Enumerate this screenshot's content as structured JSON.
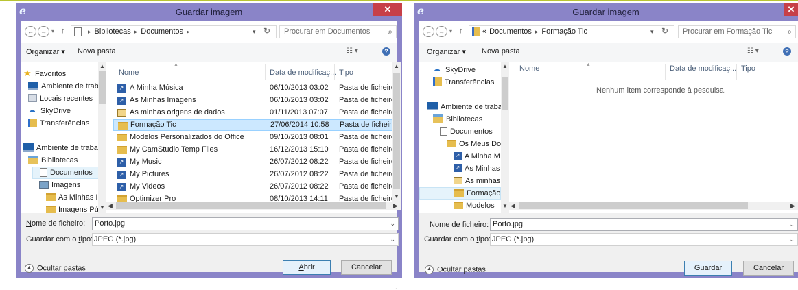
{
  "dialog_left": {
    "title": "Guardar imagem",
    "close_glyph": "✕",
    "address": {
      "segments": [
        "Bibliotecas",
        "Documentos"
      ]
    },
    "search": {
      "placeholder": "Procurar em Documentos"
    },
    "toolbar": {
      "organize": "Organizar ▾",
      "new_folder": "Nova pasta"
    },
    "nav_items": [
      {
        "label": "Favoritos",
        "icon": "star-icon"
      },
      {
        "label": "Ambiente de trab",
        "icon": "desktop-icon"
      },
      {
        "label": "Locais recentes",
        "icon": "recent-places-icon"
      },
      {
        "label": "SkyDrive",
        "icon": "cloud-icon"
      },
      {
        "label": "Transferências",
        "icon": "downloads-icon"
      },
      {
        "label": "Ambiente de traba",
        "icon": "desktop-icon"
      },
      {
        "label": "Bibliotecas",
        "icon": "library-icon"
      },
      {
        "label": "Documentos",
        "icon": "document-icon",
        "selected": true
      },
      {
        "label": "Imagens",
        "icon": "image-icon"
      },
      {
        "label": "As Minhas Im",
        "icon": "image-folder-icon"
      },
      {
        "label": "Imagens Púb",
        "icon": "image-folder-icon"
      }
    ],
    "columns": [
      "Nome",
      "Data de modificaç...",
      "Tipo"
    ],
    "files": [
      {
        "name": "A Minha Música",
        "date": "06/10/2013 03:02",
        "type": "Pasta de ficheiros",
        "icon": "shortcut-icon"
      },
      {
        "name": "As Minhas Imagens",
        "date": "06/10/2013 03:02",
        "type": "Pasta de ficheiros",
        "icon": "shortcut-icon"
      },
      {
        "name": "As minhas origens de dados",
        "date": "01/11/2013 07:07",
        "type": "Pasta de ficheiros",
        "icon": "data-source-icon"
      },
      {
        "name": "Formação Tic",
        "date": "27/06/2014 10:58",
        "type": "Pasta de ficheiros",
        "icon": "folder-icon",
        "selected": true
      },
      {
        "name": "Modelos Personalizados do Office",
        "date": "09/10/2013 08:01",
        "type": "Pasta de ficheiros",
        "icon": "folder-icon"
      },
      {
        "name": "My CamStudio Temp Files",
        "date": "16/12/2013 15:10",
        "type": "Pasta de ficheiros",
        "icon": "folder-icon"
      },
      {
        "name": "My Music",
        "date": "26/07/2012 08:22",
        "type": "Pasta de ficheiros",
        "icon": "shortcut-icon"
      },
      {
        "name": "My Pictures",
        "date": "26/07/2012 08:22",
        "type": "Pasta de ficheiros",
        "icon": "shortcut-icon"
      },
      {
        "name": "My Videos",
        "date": "26/07/2012 08:22",
        "type": "Pasta de ficheiros",
        "icon": "shortcut-icon"
      },
      {
        "name": "Optimizer Pro",
        "date": "08/10/2013 14:11",
        "type": "Pasta de ficheiros",
        "icon": "folder-icon"
      }
    ],
    "filename_label_pre": "N",
    "filename_label_rest": "ome de ficheiro:",
    "filename_value": "Porto.jpg",
    "filetype_label_pre": "Guardar com o ",
    "filetype_label_key": "t",
    "filetype_label_rest": "ipo:",
    "filetype_value": "JPEG (*.jpg)",
    "hide_folders": "Ocultar pastas",
    "primary_btn_key": "A",
    "primary_btn_rest": "brir",
    "cancel_btn": "Cancelar"
  },
  "dialog_right": {
    "title": "Guardar imagem",
    "close_glyph": "✕",
    "address": {
      "prefix": "«",
      "segments": [
        "Documentos",
        "Formação Tic"
      ]
    },
    "search": {
      "placeholder": "Procurar em Formação Tic"
    },
    "toolbar": {
      "organize": "Organizar ▾",
      "new_folder": "Nova pasta"
    },
    "nav_items": [
      {
        "label": "SkyDrive",
        "icon": "cloud-icon"
      },
      {
        "label": "Transferências",
        "icon": "downloads-icon"
      },
      {
        "label": "Ambiente de traba",
        "icon": "desktop-icon"
      },
      {
        "label": "Bibliotecas",
        "icon": "library-icon"
      },
      {
        "label": "Documentos",
        "icon": "document-icon"
      },
      {
        "label": "Os Meus Doc",
        "icon": "document-folder-icon"
      },
      {
        "label": "A Minha M",
        "icon": "shortcut-icon"
      },
      {
        "label": "As Minhas",
        "icon": "shortcut-icon"
      },
      {
        "label": "As minhas",
        "icon": "data-source-icon"
      },
      {
        "label": "Formação",
        "icon": "folder-icon",
        "selected": true
      },
      {
        "label": "Modelos Pe",
        "icon": "folder-icon"
      }
    ],
    "columns": [
      "Nome",
      "Data de modificaç...",
      "Tipo"
    ],
    "empty_message": "Nenhum item corresponde à pesquisa.",
    "filename_label_pre": "N",
    "filename_label_rest": "ome de ficheiro:",
    "filename_value": "Porto.jpg",
    "filetype_label_pre": "Guardar com o ",
    "filetype_label_key": "t",
    "filetype_label_rest": "ipo:",
    "filetype_value": "JPEG (*.jpg)",
    "hide_folders": "Ocultar pastas",
    "primary_btn_pre": "Guarda",
    "primary_btn_key": "r",
    "cancel_btn": "Cancelar"
  },
  "colors": {
    "window_frame": "#8a84c8",
    "close_button": "#c74048",
    "selection": "#cce8ff",
    "top_line": "#b9c432"
  }
}
